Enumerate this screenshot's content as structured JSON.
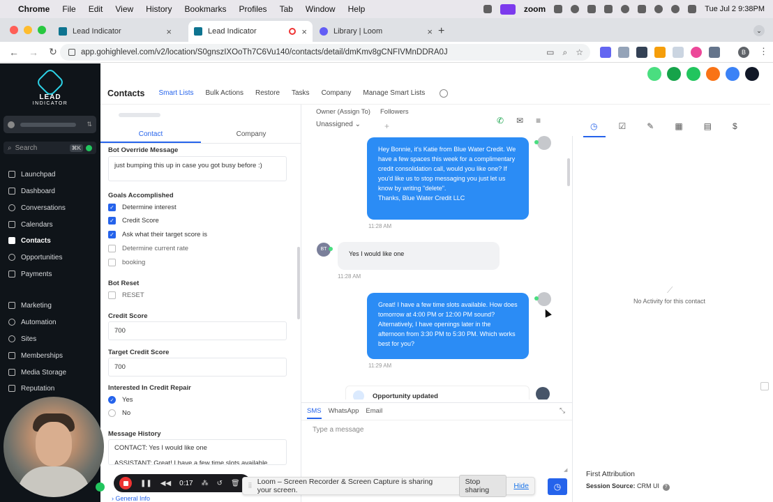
{
  "menubar": {
    "app": "Chrome",
    "items": [
      "File",
      "Edit",
      "View",
      "History",
      "Bookmarks",
      "Profiles",
      "Tab",
      "Window",
      "Help"
    ],
    "zoom": "zoom",
    "clock": "Tue Jul 2  9:38PM"
  },
  "tabs": [
    {
      "title": "Lead Indicator",
      "recording": false,
      "active": false
    },
    {
      "title": "Lead Indicator",
      "recording": true,
      "active": true
    },
    {
      "title": "Library | Loom",
      "recording": false,
      "active": false
    }
  ],
  "address": {
    "url": "app.gohighlevel.com/v2/location/S0gnszIXOoTh7C6Vu140/contacts/detail/dmKmv8gCNFIVMnDDRA0J",
    "profile_initial": "B"
  },
  "sidebar": {
    "brand_line1": "LEAD",
    "brand_line2": "INDICATOR",
    "search_placeholder": "Search",
    "search_shortcut": "⌘K",
    "items": [
      {
        "label": "Launchpad",
        "active": false
      },
      {
        "label": "Dashboard",
        "active": false
      },
      {
        "label": "Conversations",
        "active": false
      },
      {
        "label": "Calendars",
        "active": false
      },
      {
        "label": "Contacts",
        "active": true
      },
      {
        "label": "Opportunities",
        "active": false
      },
      {
        "label": "Payments",
        "active": false
      },
      {
        "label": "Marketing",
        "active": false
      },
      {
        "label": "Automation",
        "active": false
      },
      {
        "label": "Sites",
        "active": false
      },
      {
        "label": "Memberships",
        "active": false
      },
      {
        "label": "Media Storage",
        "active": false
      },
      {
        "label": "Reputation",
        "active": false
      }
    ]
  },
  "subnav": {
    "title": "Contacts",
    "items": [
      "Smart Lists",
      "Bulk Actions",
      "Restore",
      "Tasks",
      "Company",
      "Manage Smart Lists"
    ],
    "active": "Smart Lists"
  },
  "form": {
    "tabs": [
      "Contact",
      "Company"
    ],
    "bot_override_label": "Bot Override Message",
    "bot_override_value": "just bumping this up in case you got busy before :)",
    "goals_label": "Goals Accomplished",
    "goals": [
      {
        "label": "Determine interest",
        "checked": true
      },
      {
        "label": "Credit Score",
        "checked": true
      },
      {
        "label": "Ask what their target score is",
        "checked": true
      },
      {
        "label": "Determine current rate",
        "checked": false
      },
      {
        "label": "booking",
        "checked": false
      }
    ],
    "bot_reset_label": "Bot Reset",
    "bot_reset_option": "RESET",
    "credit_score_label": "Credit Score",
    "credit_score_value": "700",
    "target_label": "Target Credit Score",
    "target_value": "700",
    "interested_label": "Interested In Credit Repair",
    "interested_yes": "Yes",
    "interested_no": "No",
    "history_label": "Message History",
    "history_line1": "CONTACT:  Yes I would like one",
    "history_line2": "ASSISTANT: Great! I have a few time slots available",
    "general_info": "General Info"
  },
  "conversation": {
    "owner_label": "Owner (Assign To)",
    "owner_value": "Unassigned",
    "followers_label": "Followers",
    "messages": [
      {
        "dir": "out",
        "text": "Hey Bonnie, it's Katie from Blue Water Credit. We have a few spaces this week for a complimentary credit consolidation call, would you like one? If you'd like us to stop messaging you just let us know by writing \"delete\".\nThanks, Blue Water Credit LLC",
        "time": "11:28 AM"
      },
      {
        "dir": "in",
        "text": "Yes I would like one",
        "time": "11:28 AM",
        "initials": "BT"
      },
      {
        "dir": "out",
        "text": "Great! I have a few time slots available. How does tomorrow at 4:00 PM or 12:00 PM sound? Alternatively, I have openings later in the afternoon from 3:30 PM to 5:30 PM. Which works best for you?",
        "time": "11:29 AM"
      }
    ],
    "event": "Opportunity updated",
    "compose_tabs": [
      "SMS",
      "WhatsApp",
      "Email"
    ],
    "compose_placeholder": "Type a message"
  },
  "activity": {
    "empty_text": "No Activity for this contact",
    "first_attribution": "First Attribution",
    "session_source_label": "Session Source:",
    "session_source_value": "CRM UI"
  },
  "loom": {
    "timer": "0:17",
    "share_text": "Loom – Screen Recorder & Screen Capture is sharing your screen.",
    "stop_label": "Stop sharing",
    "hide_label": "Hide"
  },
  "colors": {
    "accent": "#2563eb",
    "bubble_out": "#2b8cf5",
    "sidebar_bg": "#0f1419"
  }
}
